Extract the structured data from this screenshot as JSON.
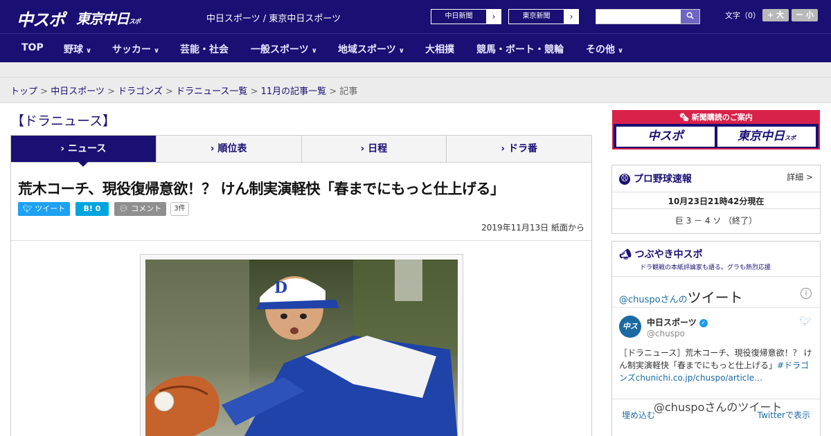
{
  "header": {
    "logo_chuspo": "中スポ",
    "logo_tokyo": "東京中日",
    "logo_tokyo_small": "スポ",
    "site_names": "中日スポーツ / 東京中日スポーツ",
    "btn_chunichi": "中日新聞",
    "btn_tokyo": "東京新聞",
    "search_placeholder": "",
    "search_icon": "search-icon",
    "font_label": "文字（0）",
    "font_larger": "+ 大",
    "font_smaller": "ー 小"
  },
  "nav": {
    "items": [
      {
        "label": "TOP",
        "has_menu": false
      },
      {
        "label": "野球",
        "has_menu": true
      },
      {
        "label": "サッカー",
        "has_menu": true
      },
      {
        "label": "芸能・社会",
        "has_menu": false
      },
      {
        "label": "一般スポーツ",
        "has_menu": true
      },
      {
        "label": "地域スポーツ",
        "has_menu": true
      },
      {
        "label": "大相撲",
        "has_menu": false
      },
      {
        "label": "競馬・ボート・競輪",
        "has_menu": false
      },
      {
        "label": "その他",
        "has_menu": true
      }
    ]
  },
  "breadcrumb": {
    "items": [
      "トップ",
      "中日スポーツ",
      "ドラゴンズ",
      "ドラニュース一覧",
      "11月の記事一覧"
    ],
    "current": "記事",
    "separator": ">"
  },
  "section_title": "【ドラニュース】",
  "tabs": [
    {
      "label": "ニュース",
      "active": true
    },
    {
      "label": "順位表",
      "active": false
    },
    {
      "label": "日程",
      "active": false
    },
    {
      "label": "ドラ番",
      "active": false
    }
  ],
  "article": {
    "headline": "荒木コーチ、現役復帰意欲！？ けん制実演軽快「春までにもっと仕上げる」",
    "tweet_label": "ツイート",
    "hatena_label": "B! 0",
    "comment_label": "コメント",
    "comment_count": "3件",
    "dateline": "2019年11月13日 紙面から"
  },
  "sidebar": {
    "ad": {
      "title": "新聞購読のご案内",
      "btn_left": "中スポ",
      "btn_right": "東京中日",
      "btn_right_small": "スポ"
    },
    "scores": {
      "title": "プロ野球速報",
      "detail": "詳細 >",
      "timestamp": "10月23日21時42分現在",
      "game": "巨 3 － 4 ソ （終了）"
    },
    "twitter": {
      "title": "つぶやき中スポ",
      "subtitle": "ドラ観戦の本紙評論家も語る。グラも熱烈応援",
      "handle_prefix": "@chuspoさんの",
      "handle_big": "ツイート",
      "account_name": "中日スポーツ",
      "account_at": "@chuspo",
      "avatar_text": "中スポ",
      "tweet_text": "［ドラニュース］荒木コーチ、現役復帰意欲！？ けん制実演軽快「春までにもっと仕上げる」",
      "tweet_link": "#ドラゴンズchunichi.co.jp/chuspo/article…",
      "embed": "埋め込む",
      "view_on_twitter": "Twitterで表示",
      "more_label": "@chuspoさんのツイート"
    }
  }
}
